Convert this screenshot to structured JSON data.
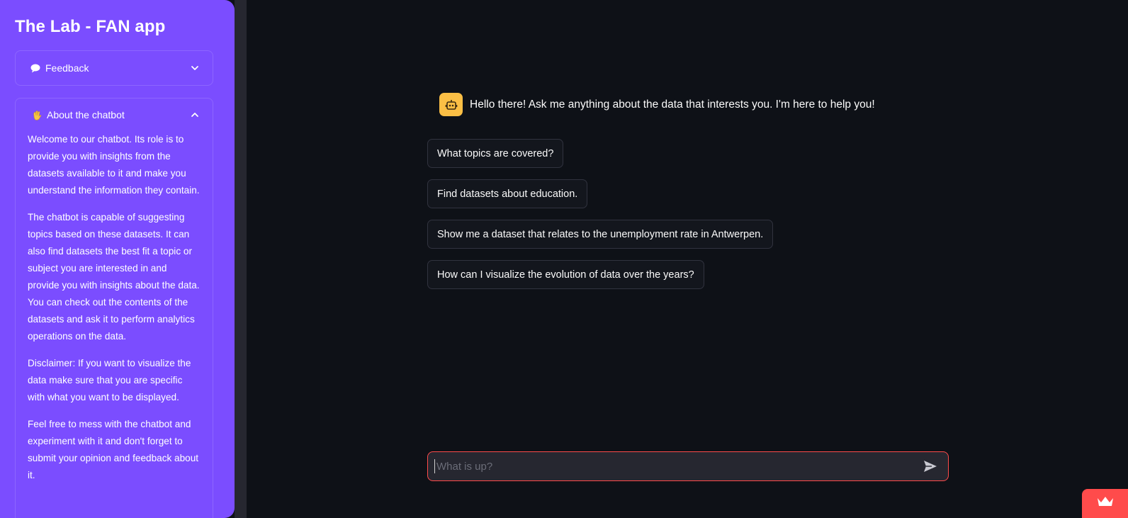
{
  "sidebar": {
    "title": "The Lab - FAN app",
    "feedback": {
      "icon": "speech-bubble-icon",
      "label": "Feedback"
    },
    "about": {
      "icon": "waving-hand-icon",
      "label": "About the chatbot",
      "paragraphs": [
        "Welcome to our chatbot. Its role is to provide you with insights from the datasets available to it and make you understand the information they contain.",
        "The chatbot is capable of suggesting topics based on these datasets. It can also find datasets the best fit a topic or subject you are interested in and provide you with insights about the data. You can check out the contents of the datasets and ask it to perform analytics operations on the data.",
        "Disclaimer: If you want to visualize the data make sure that you are specific with what you want to be displayed.",
        "Feel free to mess with the chatbot and experiment with it and don't forget to submit your opinion and feedback about it."
      ]
    }
  },
  "chat": {
    "bot_icon": "robot-icon",
    "greeting": "Hello there! Ask me anything about the data that interests you. I'm here to help you!",
    "suggestions": [
      "What topics are covered?",
      "Find datasets about education.",
      "Show me a dataset that relates to the unemployment rate in Antwerpen.",
      "How can I visualize the evolution of data over the years?"
    ],
    "input_placeholder": "What is up?",
    "send_icon": "send-icon"
  },
  "colors": {
    "sidebar_bg": "#7b4dff",
    "main_bg": "#0e1117",
    "accent": "#ff4b4b",
    "bot_avatar": "#fbbf45"
  }
}
